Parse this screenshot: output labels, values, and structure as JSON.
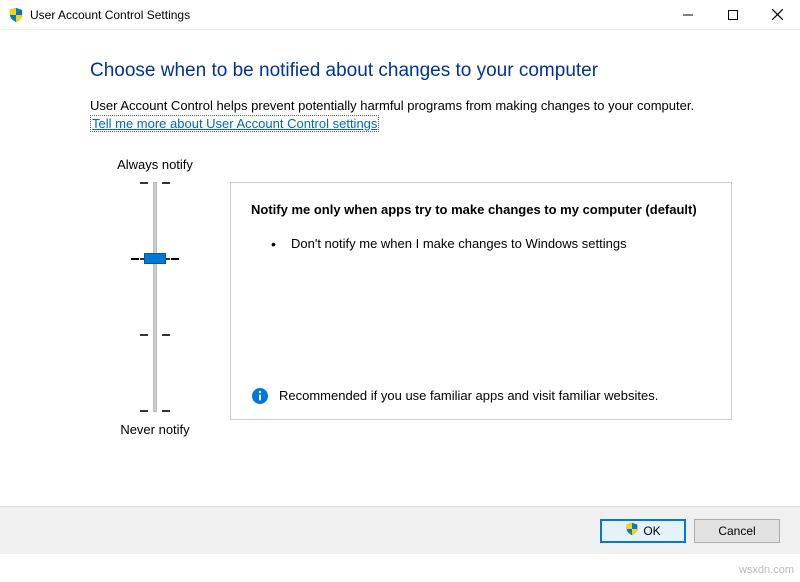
{
  "window": {
    "title": "User Account Control Settings"
  },
  "heading": "Choose when to be notified about changes to your computer",
  "description": "User Account Control helps prevent potentially harmful programs from making changes to your computer.",
  "link_text": "Tell me more about User Account Control settings",
  "slider": {
    "top_label": "Always notify",
    "bottom_label": "Never notify",
    "levels": 4,
    "selected_index": 1
  },
  "notify_box": {
    "title": "Notify me only when apps try to make changes to my computer (default)",
    "bullets": [
      "Don't notify me when I make changes to Windows settings"
    ],
    "recommendation": "Recommended if you use familiar apps and visit familiar websites."
  },
  "buttons": {
    "ok": "OK",
    "cancel": "Cancel"
  },
  "watermark": "wsxdn.com"
}
